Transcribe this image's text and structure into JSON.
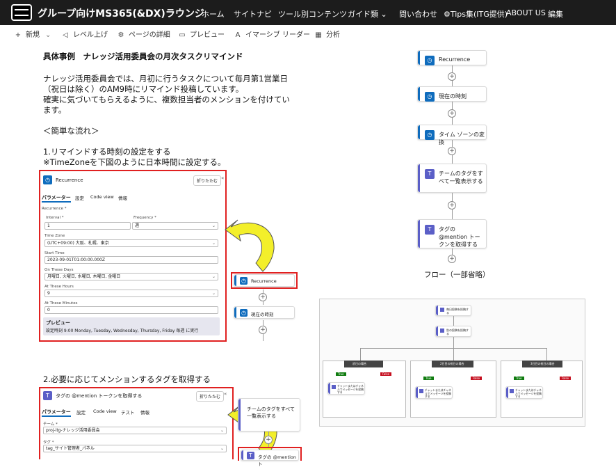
{
  "header": {
    "site_title": "グループ向けMS365(&DX)ラウンジ",
    "nav": [
      {
        "label": "ホーム"
      },
      {
        "label": "サイトナビ"
      },
      {
        "label": "ツール別コンテンツ"
      },
      {
        "label": "ガイド類 ⌄"
      },
      {
        "label": "問い合わせ"
      },
      {
        "label": "⚙Tips集(ITG提供)"
      },
      {
        "label": "ABOUT US"
      },
      {
        "label": "編集"
      }
    ]
  },
  "commandbar": {
    "new": "新規",
    "level_up": "レベル上げ",
    "page_details": "ページの詳細",
    "preview": "プレビュー",
    "immersive_reader": "イマーシブ リーダー",
    "analytics": "分析"
  },
  "content": {
    "heading": "具体事例　ナレッジ活用委員会の月次タスクリマインド",
    "para1_line1": "ナレッジ活用委員会では、月初に行うタスクについて毎月第1営業日",
    "para1_line2": "（祝日は除く）のAM9時にリマインド投稿しています。",
    "para1_line3": "確実に気づいてもらえるように、複数担当者のメンションを付けてい",
    "para1_line4": "ます。",
    "flow_heading": "＜簡単な流れ＞",
    "step1_line1": "1.リマインドする時刻の設定をする",
    "step1_line2": "※TimeZoneを下図のように日本時間に設定する。",
    "step2": "2.必要に応じてメンションするタグを取得する"
  },
  "flow_right": {
    "steps": [
      "Recurrence",
      "現在の時刻",
      "タイム ゾーンの変換",
      "チームのタグをすべて一覧表示する",
      "タグの @mention トークンを取得する"
    ],
    "caption": "フロー（一部省略）"
  },
  "recurrence_panel": {
    "title": "Recurrence",
    "collapse": "折りたたむ",
    "tabs": [
      "パラメーター",
      "設定",
      "Code view",
      "情報"
    ],
    "section": "Recurrence *",
    "interval_label": "Interval *",
    "interval_value": "1",
    "frequency_label": "Frequency *",
    "frequency_value": "週",
    "timezone_label": "Time Zone",
    "timezone_value": "(UTC+09:00) 大阪、札幌、東京",
    "start_label": "Start Time",
    "start_value": "2023-09-01T01:00:00.000Z",
    "days_label": "On These Days",
    "days_value": "月曜日, 火曜日, 水曜日, 木曜日, 金曜日",
    "hours_label": "At These Hours",
    "hours_value": "9",
    "minutes_label": "At These Minutes",
    "minutes_value": "0",
    "preview_title": "プレビュー",
    "preview_text": "設定時刻 9:00 Monday, Tuesday, Wednesday, Thursday, Friday 毎週 に実行",
    "side_cards": [
      "Recurrence",
      "現在の時刻"
    ]
  },
  "mention_panel": {
    "title": "タグの @mention トークンを取得する",
    "collapse": "折りたたむ",
    "tabs": [
      "パラメーター",
      "設定",
      "Code view",
      "テスト",
      "情報"
    ],
    "team_label": "チーム *",
    "team_value": "proj-itg-ナレッジ活用委員会",
    "tag_label": "タグ *",
    "tag_value": "tag_サイト管理者_パネル",
    "side_cards": [
      "チームのタグをすべて一覧表示する",
      "タグの @mention ト"
    ]
  },
  "mini_flow": {
    "top_cards": [
      "毎日投稿を投稿する",
      "別の投稿を投稿する"
    ],
    "branches": [
      {
        "title": "初日の場合",
        "true": "True",
        "false": "False",
        "card": "チャットまたはチャネルでメッセージを投稿する"
      },
      {
        "title": "2日目の祝日の場合",
        "true": "True",
        "false": "False",
        "card": "チャットまたはチャネルでメッセージを投稿する"
      },
      {
        "title": "3日目の祝日の場合",
        "true": "True",
        "false": "False",
        "card": "チャットまたはチャネルでメッセージを投稿する"
      }
    ]
  }
}
